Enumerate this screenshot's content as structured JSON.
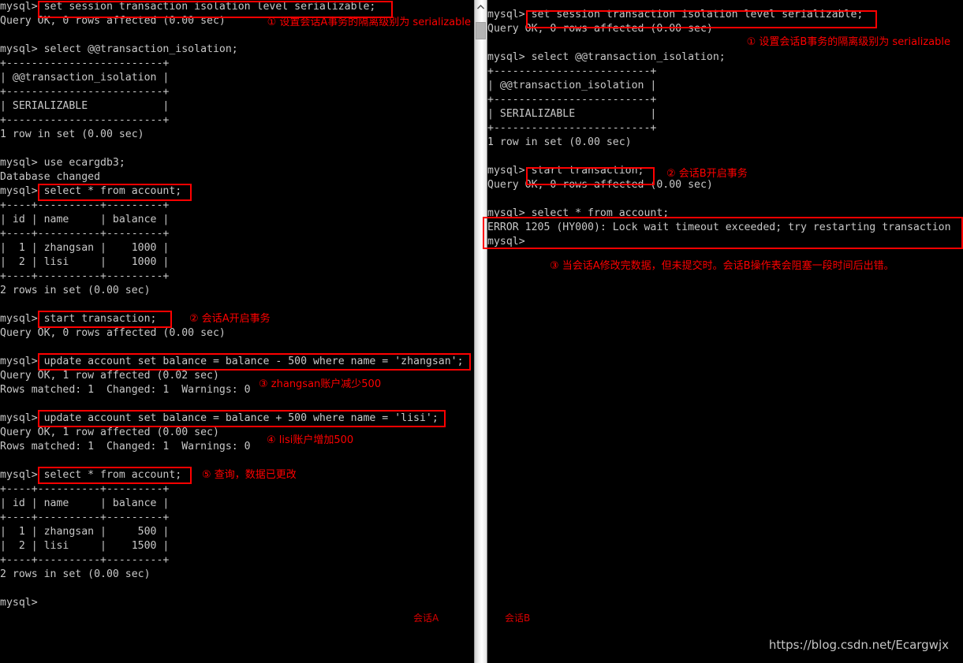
{
  "window": {
    "background_color": "#000000",
    "text_color": "#c8c8c8",
    "accent_color": "#ff0000"
  },
  "scrollbar": {
    "up_arrow_glyph": "▲",
    "thumb_label": "scroll-thumb"
  },
  "left_pane": {
    "session_label": "会话A",
    "terminal_text": "mysql> set session transaction isolation level serializable;\nQuery OK, 0 rows affected (0.00 sec)\n\nmysql> select @@transaction_isolation;\n+-------------------------+\n| @@transaction_isolation |\n+-------------------------+\n| SERIALIZABLE            |\n+-------------------------+\n1 row in set (0.00 sec)\n\nmysql> use ecargdb3;\nDatabase changed\nmysql> select * from account;\n+----+----------+---------+\n| id | name     | balance |\n+----+----------+---------+\n|  1 | zhangsan |    1000 |\n|  2 | lisi     |    1000 |\n+----+----------+---------+\n2 rows in set (0.00 sec)\n\nmysql> start transaction;\nQuery OK, 0 rows affected (0.00 sec)\n\nmysql> update account set balance = balance - 500 where name = 'zhangsan';\nQuery OK, 1 row affected (0.02 sec)\nRows matched: 1  Changed: 1  Warnings: 0\n\nmysql> update account set balance = balance + 500 where name = 'lisi';\nQuery OK, 1 row affected (0.00 sec)\nRows matched: 1  Changed: 1  Warnings: 0\n\nmysql> select * from account;\n+----+----------+---------+\n| id | name     | balance |\n+----+----------+---------+\n|  1 | zhangsan |     500 |\n|  2 | lisi     |    1500 |\n+----+----------+---------+\n2 rows in set (0.00 sec)\n\nmysql>",
    "annotations": [
      {
        "id": "a1",
        "text": "① 设置会话A事务的隔离级别为 serializable"
      },
      {
        "id": "a2",
        "text": "② 会话A开启事务"
      },
      {
        "id": "a3",
        "text": "③ zhangsan账户减少500"
      },
      {
        "id": "a4",
        "text": "④ lisi账户增加500"
      },
      {
        "id": "a5",
        "text": "⑤ 查询，数据已更改"
      }
    ],
    "highlights": [
      {
        "id": "h1",
        "target": "set session transaction isolation level serializable;"
      },
      {
        "id": "h2",
        "target": "select * from account;"
      },
      {
        "id": "h3",
        "target": "start transaction;"
      },
      {
        "id": "h4",
        "target": "update account set balance = balance - 500 where name = 'zhangsan';"
      },
      {
        "id": "h5",
        "target": "update account set balance = balance + 500 where name = 'lisi';"
      },
      {
        "id": "h6",
        "target": "select * from account;"
      }
    ]
  },
  "right_pane": {
    "session_label": "会话B",
    "terminal_text": "mysql> set session transaction isolation level serializable;\nQuery OK, 0 rows affected (0.00 sec)\n\nmysql> select @@transaction_isolation;\n+-------------------------+\n| @@transaction_isolation |\n+-------------------------+\n| SERIALIZABLE            |\n+-------------------------+\n1 row in set (0.00 sec)\n\nmysql> start transaction;\nQuery OK, 0 rows affected (0.00 sec)\n\nmysql> select * from account;\nERROR 1205 (HY000): Lock wait timeout exceeded; try restarting transaction\nmysql>",
    "annotations": [
      {
        "id": "b1",
        "text": "① 设置会话B事务的隔离级别为 serializable"
      },
      {
        "id": "b2",
        "text": "② 会话B开启事务"
      },
      {
        "id": "b3",
        "text": "③ 当会话A修改完数据，但未提交时。会话B操作表会阻塞一段时间后出错。"
      }
    ],
    "highlights": [
      {
        "id": "hb1",
        "target": "set session transaction isolation level serializable;"
      },
      {
        "id": "hb2",
        "target": "start transaction;"
      },
      {
        "id": "hb3",
        "target": "select * from account; / ERROR 1205 (HY000): Lock wait timeout exceeded; try restarting transaction"
      }
    ]
  },
  "watermark": {
    "text": "https://blog.csdn.net/Ecargwjx"
  }
}
